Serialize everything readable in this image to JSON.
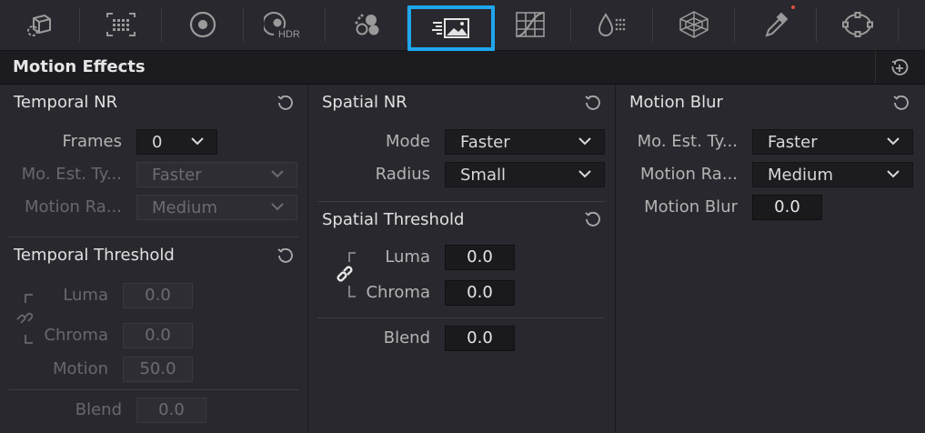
{
  "toolbar": {
    "items": [
      {
        "icon": "camera-raw-icon"
      },
      {
        "icon": "color-match-icon"
      },
      {
        "icon": "color-wheels-icon"
      },
      {
        "icon": "hdr-wheels-icon",
        "label": "HDR"
      },
      {
        "icon": "rgb-mixer-icon"
      },
      {
        "icon": "motion-effects-icon",
        "active": true
      },
      {
        "icon": "curves-icon"
      },
      {
        "icon": "color-warper-icon"
      },
      {
        "icon": "qualifier-icon"
      },
      {
        "icon": "eyedropper-icon"
      },
      {
        "icon": "window-icon"
      }
    ]
  },
  "panel": {
    "title": "Motion Effects"
  },
  "temporal_nr": {
    "title": "Temporal NR",
    "frames_label": "Frames",
    "frames_value": "0",
    "mo_est_label": "Mo. Est. Ty...",
    "mo_est_value": "Faster",
    "motion_range_label": "Motion Ra...",
    "motion_range_value": "Medium"
  },
  "temporal_threshold": {
    "title": "Temporal Threshold",
    "luma_label": "Luma",
    "luma_value": "0.0",
    "chroma_label": "Chroma",
    "chroma_value": "0.0",
    "motion_label": "Motion",
    "motion_value": "50.0",
    "blend_label": "Blend",
    "blend_value": "0.0"
  },
  "spatial_nr": {
    "title": "Spatial NR",
    "mode_label": "Mode",
    "mode_value": "Faster",
    "radius_label": "Radius",
    "radius_value": "Small"
  },
  "spatial_threshold": {
    "title": "Spatial Threshold",
    "luma_label": "Luma",
    "luma_value": "0.0",
    "chroma_label": "Chroma",
    "chroma_value": "0.0",
    "blend_label": "Blend",
    "blend_value": "0.0"
  },
  "motion_blur": {
    "title": "Motion Blur",
    "mo_est_label": "Mo. Est. Ty...",
    "mo_est_value": "Faster",
    "motion_range_label": "Motion Ra...",
    "motion_range_value": "Medium",
    "blur_label": "Motion Blur",
    "blur_value": "0.0"
  },
  "colors": {
    "accent": "#1fa6ee",
    "background": "#28282e",
    "header": "#1c1c20"
  }
}
